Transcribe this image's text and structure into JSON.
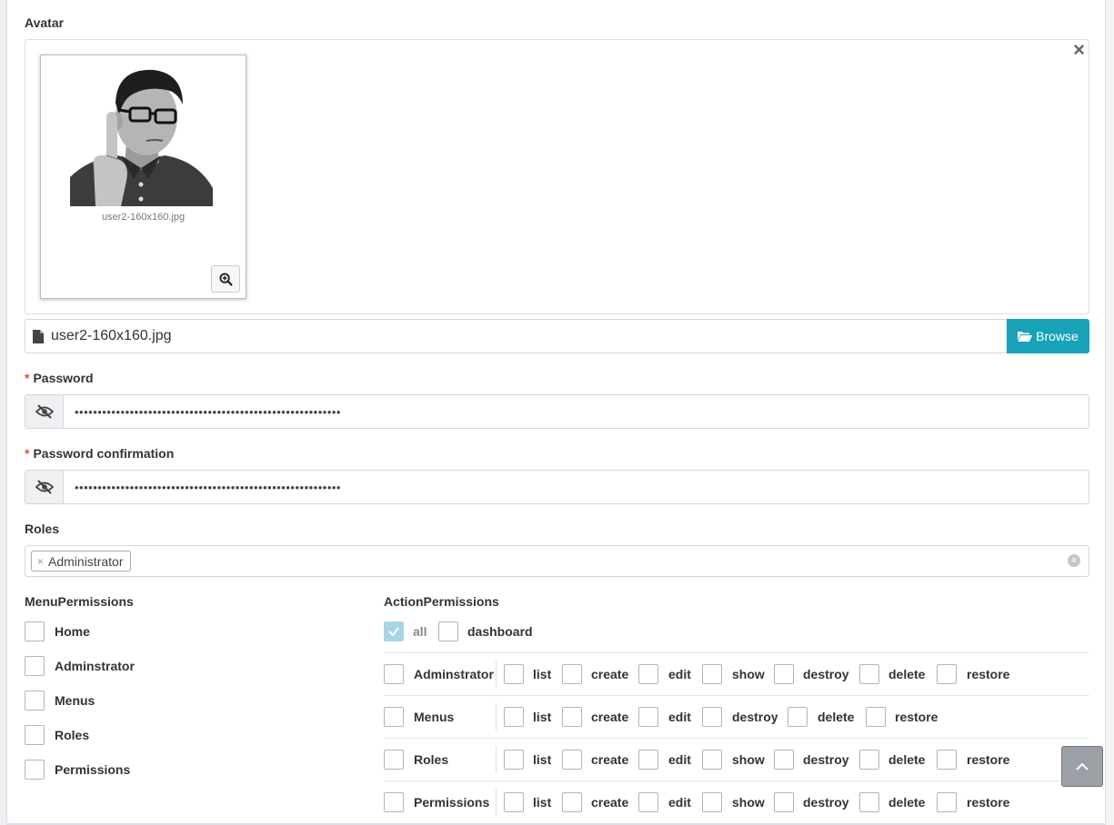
{
  "avatar": {
    "label": "Avatar",
    "close_symbol": "×",
    "thumbnail_caption": "user2-160x160.jpg",
    "file_name": "user2-160x160.jpg",
    "browse_label": "Browse",
    "icons": [
      "close-icon",
      "zoom-in-icon",
      "file-icon",
      "folder-open-icon"
    ]
  },
  "password": {
    "label": "Password",
    "required_mark": "*",
    "masked_value": "••••••••••••••••••••••••••••••••••••••••••••••••••••••••••"
  },
  "password_confirmation": {
    "label": "Password confirmation",
    "required_mark": "*",
    "masked_value": "••••••••••••••••••••••••••••••••••••••••••••••••••••••••••"
  },
  "roles": {
    "label": "Roles",
    "tag_remove": "×",
    "selected": [
      "Administrator"
    ],
    "clear_symbol": "×"
  },
  "menu_permissions": {
    "label": "MenuPermissions",
    "items": [
      "Home",
      "Adminstrator",
      "Menus",
      "Roles",
      "Permissions"
    ]
  },
  "action_permissions": {
    "label": "ActionPermissions",
    "top": [
      {
        "label": "all",
        "checked": true
      },
      {
        "label": "dashboard",
        "checked": false
      }
    ],
    "rows": [
      {
        "name": "Adminstrator",
        "actions": [
          "list",
          "create",
          "edit",
          "show",
          "destroy",
          "delete",
          "restore"
        ]
      },
      {
        "name": "Menus",
        "actions": [
          "list",
          "create",
          "edit",
          "destroy",
          "delete",
          "restore"
        ]
      },
      {
        "name": "Roles",
        "actions": [
          "list",
          "create",
          "edit",
          "show",
          "destroy",
          "delete",
          "restore"
        ]
      },
      {
        "name": "Permissions",
        "actions": [
          "list",
          "create",
          "edit",
          "show",
          "destroy",
          "delete",
          "restore"
        ]
      }
    ]
  },
  "colors": {
    "browse_button": "#17a2b8",
    "required_mark": "#dd4b39",
    "checked_checkbox": "#a8d6e6"
  }
}
